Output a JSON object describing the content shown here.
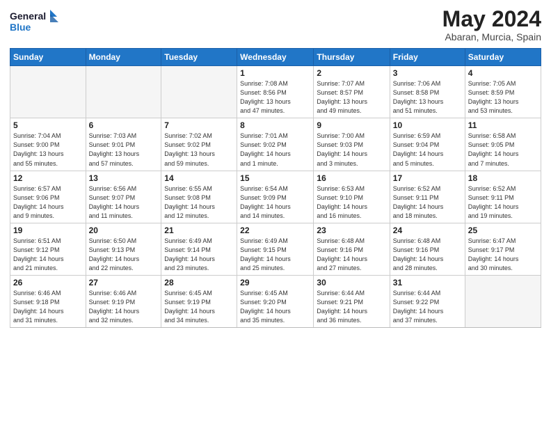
{
  "logo": {
    "general": "General",
    "blue": "Blue"
  },
  "header": {
    "month_year": "May 2024",
    "location": "Abaran, Murcia, Spain"
  },
  "days_of_week": [
    "Sunday",
    "Monday",
    "Tuesday",
    "Wednesday",
    "Thursday",
    "Friday",
    "Saturday"
  ],
  "weeks": [
    [
      {
        "day": "",
        "info": ""
      },
      {
        "day": "",
        "info": ""
      },
      {
        "day": "",
        "info": ""
      },
      {
        "day": "1",
        "info": "Sunrise: 7:08 AM\nSunset: 8:56 PM\nDaylight: 13 hours\nand 47 minutes."
      },
      {
        "day": "2",
        "info": "Sunrise: 7:07 AM\nSunset: 8:57 PM\nDaylight: 13 hours\nand 49 minutes."
      },
      {
        "day": "3",
        "info": "Sunrise: 7:06 AM\nSunset: 8:58 PM\nDaylight: 13 hours\nand 51 minutes."
      },
      {
        "day": "4",
        "info": "Sunrise: 7:05 AM\nSunset: 8:59 PM\nDaylight: 13 hours\nand 53 minutes."
      }
    ],
    [
      {
        "day": "5",
        "info": "Sunrise: 7:04 AM\nSunset: 9:00 PM\nDaylight: 13 hours\nand 55 minutes."
      },
      {
        "day": "6",
        "info": "Sunrise: 7:03 AM\nSunset: 9:01 PM\nDaylight: 13 hours\nand 57 minutes."
      },
      {
        "day": "7",
        "info": "Sunrise: 7:02 AM\nSunset: 9:02 PM\nDaylight: 13 hours\nand 59 minutes."
      },
      {
        "day": "8",
        "info": "Sunrise: 7:01 AM\nSunset: 9:02 PM\nDaylight: 14 hours\nand 1 minute."
      },
      {
        "day": "9",
        "info": "Sunrise: 7:00 AM\nSunset: 9:03 PM\nDaylight: 14 hours\nand 3 minutes."
      },
      {
        "day": "10",
        "info": "Sunrise: 6:59 AM\nSunset: 9:04 PM\nDaylight: 14 hours\nand 5 minutes."
      },
      {
        "day": "11",
        "info": "Sunrise: 6:58 AM\nSunset: 9:05 PM\nDaylight: 14 hours\nand 7 minutes."
      }
    ],
    [
      {
        "day": "12",
        "info": "Sunrise: 6:57 AM\nSunset: 9:06 PM\nDaylight: 14 hours\nand 9 minutes."
      },
      {
        "day": "13",
        "info": "Sunrise: 6:56 AM\nSunset: 9:07 PM\nDaylight: 14 hours\nand 11 minutes."
      },
      {
        "day": "14",
        "info": "Sunrise: 6:55 AM\nSunset: 9:08 PM\nDaylight: 14 hours\nand 12 minutes."
      },
      {
        "day": "15",
        "info": "Sunrise: 6:54 AM\nSunset: 9:09 PM\nDaylight: 14 hours\nand 14 minutes."
      },
      {
        "day": "16",
        "info": "Sunrise: 6:53 AM\nSunset: 9:10 PM\nDaylight: 14 hours\nand 16 minutes."
      },
      {
        "day": "17",
        "info": "Sunrise: 6:52 AM\nSunset: 9:11 PM\nDaylight: 14 hours\nand 18 minutes."
      },
      {
        "day": "18",
        "info": "Sunrise: 6:52 AM\nSunset: 9:11 PM\nDaylight: 14 hours\nand 19 minutes."
      }
    ],
    [
      {
        "day": "19",
        "info": "Sunrise: 6:51 AM\nSunset: 9:12 PM\nDaylight: 14 hours\nand 21 minutes."
      },
      {
        "day": "20",
        "info": "Sunrise: 6:50 AM\nSunset: 9:13 PM\nDaylight: 14 hours\nand 22 minutes."
      },
      {
        "day": "21",
        "info": "Sunrise: 6:49 AM\nSunset: 9:14 PM\nDaylight: 14 hours\nand 23 minutes."
      },
      {
        "day": "22",
        "info": "Sunrise: 6:49 AM\nSunset: 9:15 PM\nDaylight: 14 hours\nand 25 minutes."
      },
      {
        "day": "23",
        "info": "Sunrise: 6:48 AM\nSunset: 9:16 PM\nDaylight: 14 hours\nand 27 minutes."
      },
      {
        "day": "24",
        "info": "Sunrise: 6:48 AM\nSunset: 9:16 PM\nDaylight: 14 hours\nand 28 minutes."
      },
      {
        "day": "25",
        "info": "Sunrise: 6:47 AM\nSunset: 9:17 PM\nDaylight: 14 hours\nand 30 minutes."
      }
    ],
    [
      {
        "day": "26",
        "info": "Sunrise: 6:46 AM\nSunset: 9:18 PM\nDaylight: 14 hours\nand 31 minutes."
      },
      {
        "day": "27",
        "info": "Sunrise: 6:46 AM\nSunset: 9:19 PM\nDaylight: 14 hours\nand 32 minutes."
      },
      {
        "day": "28",
        "info": "Sunrise: 6:45 AM\nSunset: 9:19 PM\nDaylight: 14 hours\nand 34 minutes."
      },
      {
        "day": "29",
        "info": "Sunrise: 6:45 AM\nSunset: 9:20 PM\nDaylight: 14 hours\nand 35 minutes."
      },
      {
        "day": "30",
        "info": "Sunrise: 6:44 AM\nSunset: 9:21 PM\nDaylight: 14 hours\nand 36 minutes."
      },
      {
        "day": "31",
        "info": "Sunrise: 6:44 AM\nSunset: 9:22 PM\nDaylight: 14 hours\nand 37 minutes."
      },
      {
        "day": "",
        "info": ""
      }
    ]
  ]
}
